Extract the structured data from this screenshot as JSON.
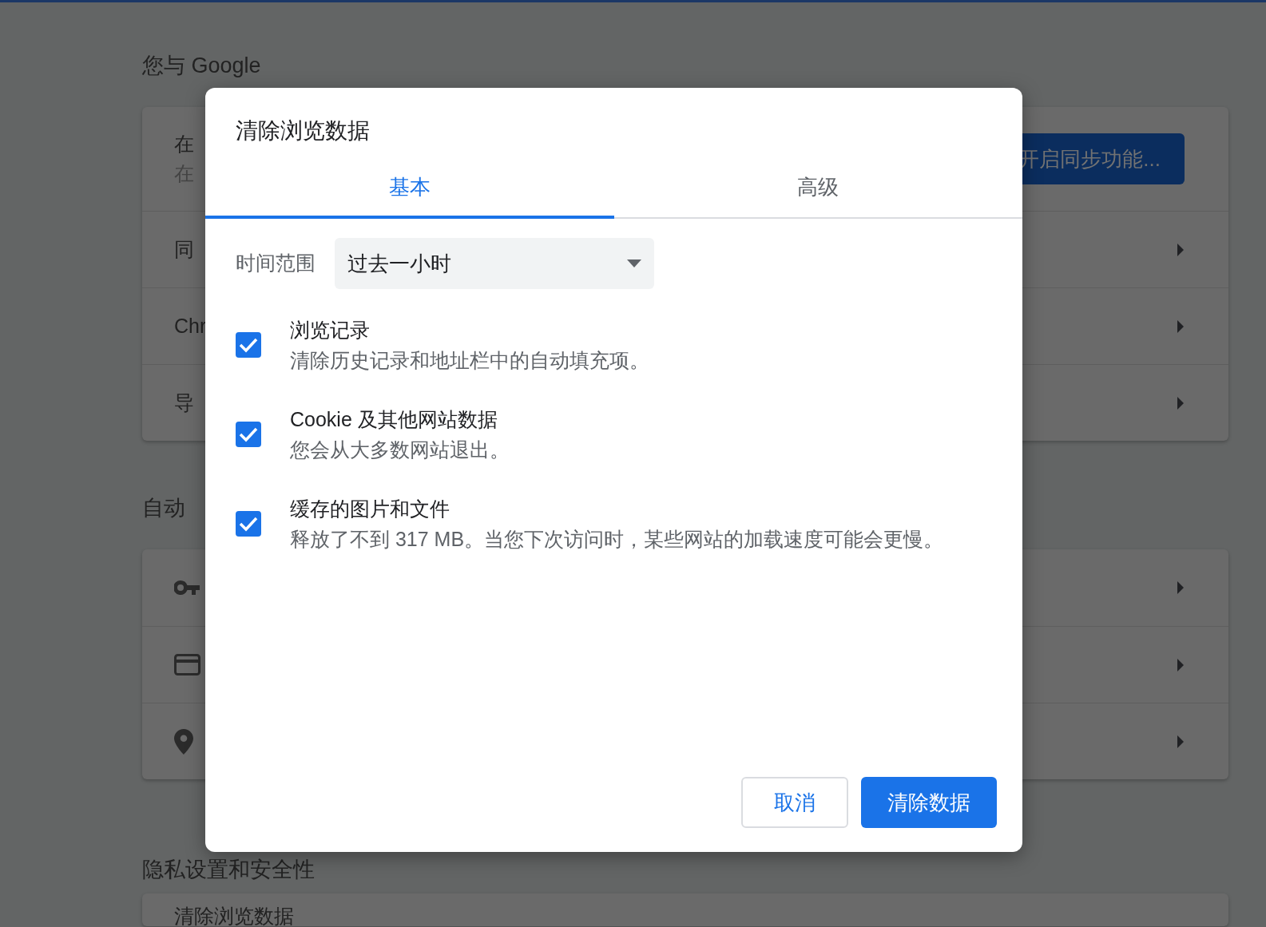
{
  "page": {
    "sections": [
      {
        "title": "您与 Google",
        "rows": [
          {
            "kind": "account",
            "title": "在",
            "subtitle": "在",
            "button": "开启同步功能..."
          },
          {
            "kind": "link",
            "title": "同"
          },
          {
            "kind": "link",
            "title": "Chr"
          },
          {
            "kind": "link",
            "title": "导"
          }
        ]
      },
      {
        "title": "自动",
        "rows": [
          {
            "kind": "password"
          },
          {
            "kind": "payment"
          },
          {
            "kind": "address"
          }
        ]
      },
      {
        "title": "隐私设置和安全性",
        "rows": [
          {
            "kind": "link",
            "title": "清除浏览数据"
          }
        ]
      }
    ]
  },
  "dialog": {
    "title": "清除浏览数据",
    "tabs": [
      {
        "label": "基本",
        "selected": true
      },
      {
        "label": "高级",
        "selected": false
      }
    ],
    "time_range": {
      "label": "时间范围",
      "value": "过去一小时"
    },
    "options": [
      {
        "title": "浏览记录",
        "description": "清除历史记录和地址栏中的自动填充项。",
        "checked": true
      },
      {
        "title": "Cookie 及其他网站数据",
        "description": "您会从大多数网站退出。",
        "checked": true
      },
      {
        "title": "缓存的图片和文件",
        "description": "释放了不到 317 MB。当您下次访问时，某些网站的加载速度可能会更慢。",
        "checked": true
      }
    ],
    "buttons": [
      {
        "label": "取消",
        "kind": "secondary"
      },
      {
        "label": "清除数据",
        "kind": "primary"
      }
    ]
  }
}
